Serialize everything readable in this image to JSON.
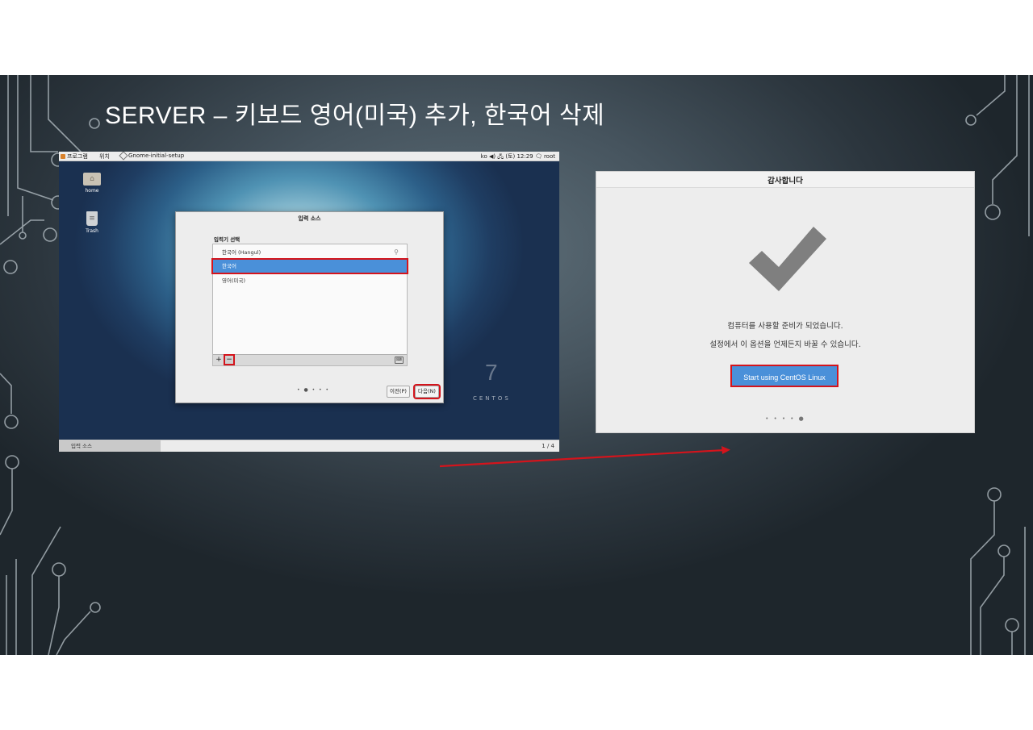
{
  "slide": {
    "title": "SERVER – 키보드 영어(미국) 추가, 한국어 삭제"
  },
  "desktop": {
    "topbar": {
      "apps": "프로그램",
      "places": "위치",
      "task": "Gnome-initial-setup",
      "status": "ko ◀) 🖧 (토) 12:29 🗨 root"
    },
    "icons": [
      {
        "label": "home"
      },
      {
        "label": "Trash"
      }
    ],
    "dialog": {
      "title": "입력 소스",
      "section_label": "입력기 선택",
      "rows": [
        {
          "label": "한국어 (Hangul)"
        },
        {
          "label": "한국어"
        },
        {
          "label": "영어(미국)"
        }
      ],
      "add_label": "+",
      "remove_label": "−",
      "pager": "• ● • • •",
      "prev_label": "이전(P)",
      "next_label": "다음(N)"
    },
    "brand": {
      "number": "7",
      "word": "CENTOS"
    },
    "bottombar": {
      "task": "입력 소스",
      "workspace": "1 / 4"
    }
  },
  "finish": {
    "title": "감사합니다",
    "line1": "컴퓨터를 사용할 준비가 되었습니다.",
    "line2": "설정에서 이 옵션을 언제든지 바꿀 수 있습니다.",
    "start_button": "Start using CentOS Linux",
    "pager": "• • • • ●"
  },
  "colors": {
    "highlight": "#d4141c",
    "selection": "#4a90d9",
    "checkmark": "#7f7f7f"
  }
}
